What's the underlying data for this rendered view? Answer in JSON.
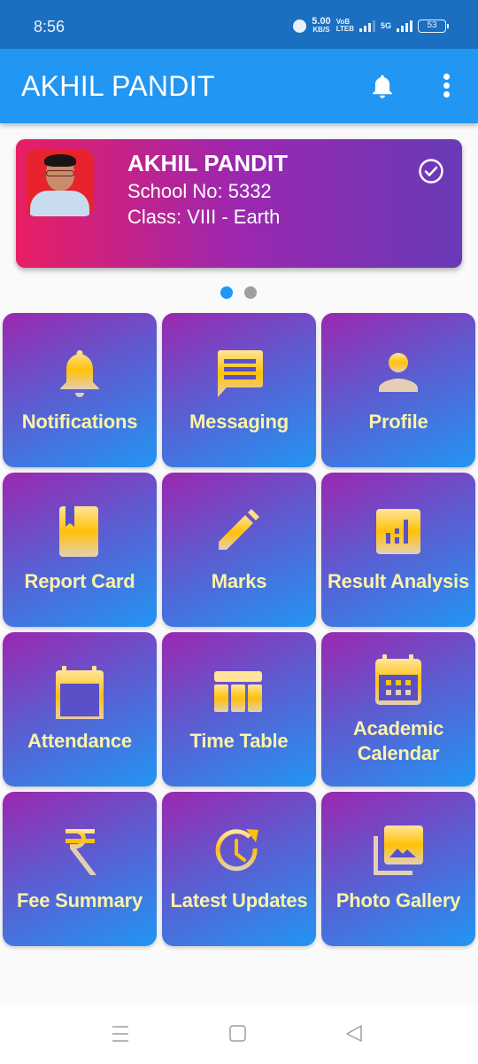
{
  "status_bar": {
    "time": "8:56",
    "speed_value": "5.00",
    "speed_unit": "KB/S",
    "volte_top": "VoB",
    "volte_bottom": "LTEB",
    "network": "5G",
    "battery": "53"
  },
  "app_bar": {
    "title": "AKHIL PANDIT",
    "notifications_icon": "bell-icon",
    "menu_icon": "more-vert-icon"
  },
  "student_card": {
    "name": "AKHIL PANDIT",
    "school_no": "School No: 5332",
    "class": "Class: VIII - Earth",
    "selected_icon": "check-circle-icon",
    "gradient": [
      "#e91e63",
      "#9c27b0",
      "#673ab7"
    ]
  },
  "carousel": {
    "pages": 2,
    "active_page": 1,
    "active_color": "#2196f3",
    "inactive_color": "#9e9e9e"
  },
  "menu": {
    "tiles": [
      {
        "label": "Notifications",
        "icon": "bell-icon"
      },
      {
        "label": "Messaging",
        "icon": "message-icon"
      },
      {
        "label": "Profile",
        "icon": "person-icon"
      },
      {
        "label": "Report Card",
        "icon": "bookmark-book-icon"
      },
      {
        "label": "Marks",
        "icon": "pencil-icon"
      },
      {
        "label": "Result Analysis",
        "icon": "bar-chart-icon"
      },
      {
        "label": "Attendance",
        "icon": "calendar-blank-icon"
      },
      {
        "label": "Time Table",
        "icon": "table-icon"
      },
      {
        "label": "Academic Calendar",
        "icon": "calendar-grid-icon"
      },
      {
        "label": "Fee Summary",
        "icon": "rupee-icon"
      },
      {
        "label": "Latest Updates",
        "icon": "update-clock-icon"
      },
      {
        "label": "Photo Gallery",
        "icon": "photo-library-icon"
      }
    ],
    "tile_gradient": [
      "#9c27b0",
      "#5e5bd0",
      "#2196f3"
    ],
    "label_color": "#fdf3a8",
    "icon_gradient": [
      "#ffe082",
      "#ffc107",
      "#e0c8a8"
    ]
  },
  "nav_bar": {
    "recent_icon": "menu-lines-icon",
    "home_icon": "home-square-icon",
    "back_icon": "back-triangle-icon"
  }
}
